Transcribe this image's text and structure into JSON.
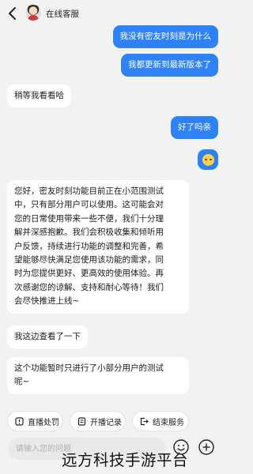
{
  "header": {
    "title": "在线客服"
  },
  "messages": [
    {
      "from": "user",
      "text": "我没有密友时刻是为什么"
    },
    {
      "from": "user",
      "text": "我都更新到最新版本了"
    },
    {
      "from": "agent",
      "text": "稍等我看看哈"
    },
    {
      "from": "user",
      "text": "好了吗亲"
    },
    {
      "from": "user",
      "emoji": "grimacing-face"
    },
    {
      "from": "agent",
      "lines": [
        "您好，密友时刻功能目前正在小范围测试",
        "中，只有部分用户可以使用。这可能会对",
        "您的日常使用带来一些不便，我们十分理",
        "解并深感抱歉。我们会积极收集和倾听用",
        "户反馈，持续进行功能的调整和完善，希",
        "望能够尽快满足您使用该功能的需求，同",
        "时为您提供更好、更高效的使用体验。再",
        "次感谢您的谅解、支持和耐心等待！我们",
        "会尽快推进上线~"
      ]
    },
    {
      "from": "agent",
      "text": "我这边查看了一下"
    },
    {
      "from": "agent",
      "lines": [
        "这个功能暂时只进行了小部分用户的测试",
        "呢~"
      ]
    }
  ],
  "quick_actions": [
    {
      "label": "直播处罚",
      "icon": "report-icon"
    },
    {
      "label": "开播记录",
      "icon": "record-icon"
    },
    {
      "label": "结束服务",
      "icon": "exit-icon"
    }
  ],
  "composer": {
    "placeholder": "请输入您的问题"
  },
  "watermark": "远方科技手游平台",
  "colors": {
    "accent": "#2f82f5",
    "background": "#f2f2f2"
  }
}
